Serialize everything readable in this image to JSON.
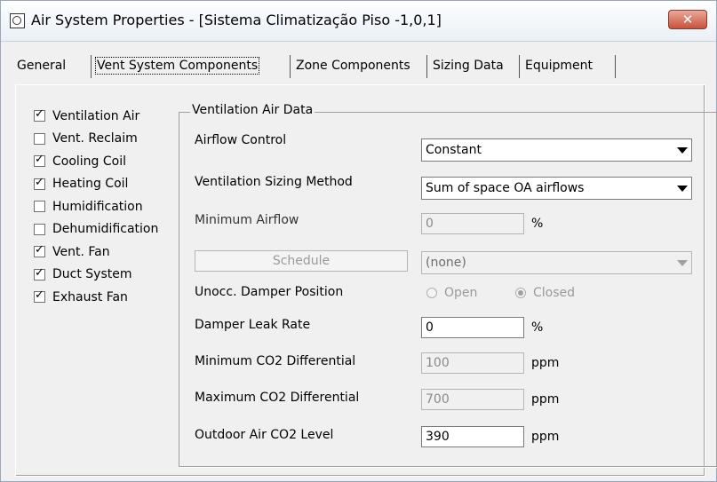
{
  "window": {
    "title": "Air System Properties - [Sistema Climatização Piso -1,0,1]",
    "close_label": "✕"
  },
  "tabs": [
    {
      "label": "General"
    },
    {
      "label": "Vent System Components"
    },
    {
      "label": "Zone Components"
    },
    {
      "label": "Sizing Data"
    },
    {
      "label": "Equipment"
    }
  ],
  "components": [
    {
      "label": "Ventilation Air",
      "checked": true
    },
    {
      "label": "Vent. Reclaim",
      "checked": false
    },
    {
      "label": "Cooling Coil",
      "checked": true
    },
    {
      "label": "Heating Coil",
      "checked": true
    },
    {
      "label": "Humidification",
      "checked": false
    },
    {
      "label": "Dehumidification",
      "checked": false
    },
    {
      "label": "Vent. Fan",
      "checked": true
    },
    {
      "label": "Duct System",
      "checked": true
    },
    {
      "label": "Exhaust Fan",
      "checked": true
    }
  ],
  "vent": {
    "group_title": "Ventilation Air Data",
    "airflow_control_label": "Airflow Control",
    "airflow_control_value": "Constant",
    "sizing_method_label": "Ventilation Sizing Method",
    "sizing_method_value": "Sum of space OA airflows",
    "min_airflow_label": "Minimum Airflow",
    "min_airflow_value": "0",
    "min_airflow_unit": "%",
    "schedule_button": "Schedule",
    "schedule_value": "(none)",
    "damper_position_label": "Unocc. Damper Position",
    "damper_open": "Open",
    "damper_closed": "Closed",
    "leak_rate_label": "Damper Leak Rate",
    "leak_rate_value": "0",
    "leak_rate_unit": "%",
    "min_co2_label": "Minimum CO2 Differential",
    "min_co2_value": "100",
    "min_co2_unit": "ppm",
    "max_co2_label": "Maximum CO2 Differential",
    "max_co2_value": "700",
    "max_co2_unit": "ppm",
    "outdoor_co2_label": "Outdoor Air CO2 Level",
    "outdoor_co2_value": "390",
    "outdoor_co2_unit": "ppm"
  }
}
